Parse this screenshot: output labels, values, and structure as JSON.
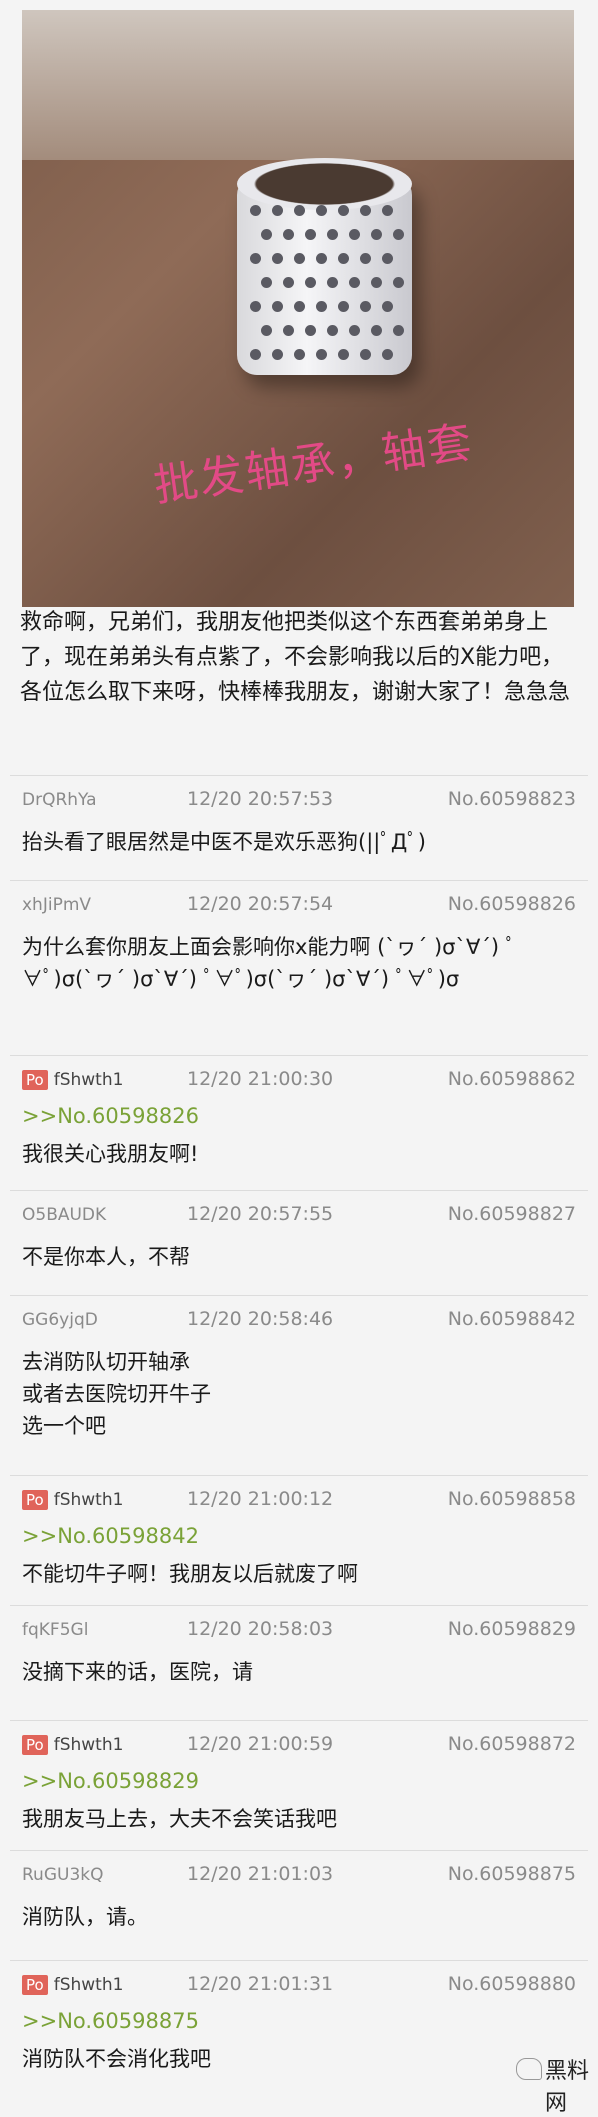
{
  "photo": {
    "alt_icon": "bearing-photo",
    "caption": "批发轴承，轴套"
  },
  "intro": "救命啊，兄弟们，我朋友他把类似这个东西套弟弟身上了，现在弟弟头有点紫了，不会影响我以后的X能力吧，各位怎么取下来呀，快棒棒我朋友，谢谢大家了！急急急",
  "posts": [
    {
      "uid": "DrQRhYa",
      "po": false,
      "date": "12/20 20:57:53",
      "no": "No.60598823",
      "ref": "",
      "body": "抬头看了眼居然是中医不是欢乐恶狗(||ﾟДﾟ)"
    },
    {
      "uid": "xhJiPmV",
      "po": false,
      "date": "12/20 20:57:54",
      "no": "No.60598826",
      "ref": "",
      "body": "为什么套你朋友上面会影响你x能力啊 (`ヮ´ )σ`∀´) ﾟ∀ﾟ)σ(`ヮ´ )σ`∀´) ﾟ∀ﾟ)σ(`ヮ´ )σ`∀´) ﾟ∀ﾟ)σ"
    },
    {
      "uid": "fShwth1",
      "po": true,
      "po_label": "Po",
      "date": "12/20 21:00:30",
      "no": "No.60598862",
      "ref": ">>No.60598826",
      "body": "我很关心我朋友啊!"
    },
    {
      "uid": "O5BAUDK",
      "po": false,
      "date": "12/20 20:57:55",
      "no": "No.60598827",
      "ref": "",
      "body": "不是你本人，不帮"
    },
    {
      "uid": "GG6yjqD",
      "po": false,
      "date": "12/20 20:58:46",
      "no": "No.60598842",
      "ref": "",
      "body": "去消防队切开轴承\n或者去医院切开牛子\n选一个吧"
    },
    {
      "uid": "fShwth1",
      "po": true,
      "po_label": "Po",
      "date": "12/20 21:00:12",
      "no": "No.60598858",
      "ref": ">>No.60598842",
      "body": "不能切牛子啊！我朋友以后就废了啊"
    },
    {
      "uid": "fqKF5Gl",
      "po": false,
      "date": "12/20 20:58:03",
      "no": "No.60598829",
      "ref": "",
      "body": "没摘下来的话，医院，请"
    },
    {
      "uid": "fShwth1",
      "po": true,
      "po_label": "Po",
      "date": "12/20 21:00:59",
      "no": "No.60598872",
      "ref": ">>No.60598829",
      "body": "我朋友马上去，大夫不会笑话我吧"
    },
    {
      "uid": "RuGU3kQ",
      "po": false,
      "date": "12/20 21:01:03",
      "no": "No.60598875",
      "ref": "",
      "body": "消防队，请。"
    },
    {
      "uid": "fShwth1",
      "po": true,
      "po_label": "Po",
      "date": "12/20 21:01:31",
      "no": "No.60598880",
      "ref": ">>No.60598875",
      "body": "消防队不会消化我吧"
    }
  ],
  "watermark": "黑料网"
}
